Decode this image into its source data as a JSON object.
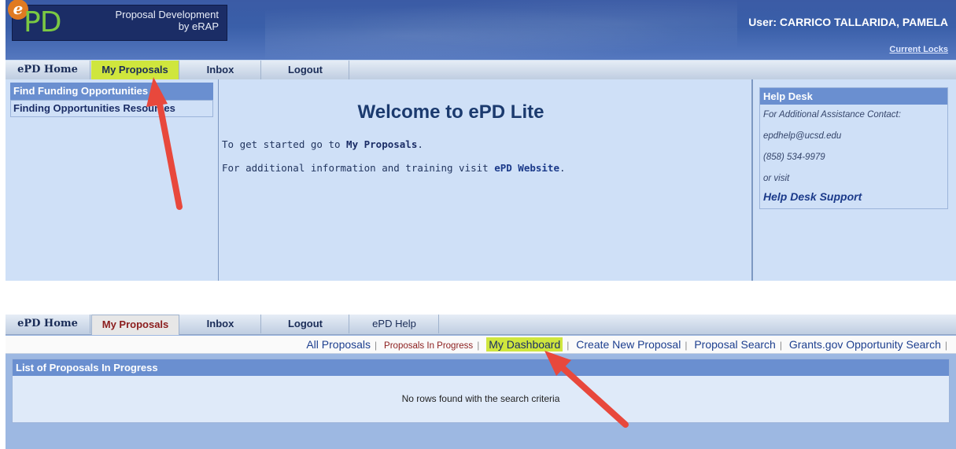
{
  "top": {
    "logo": {
      "letter": "e",
      "product": "PD",
      "title_line1": "Proposal Development",
      "title_line2": "by eRAP"
    },
    "user": "User:  CARRICO TALLARIDA, PAMELA",
    "current_locks": "Current Locks",
    "nav": [
      "ePD Home",
      "My Proposals",
      "Inbox",
      "Logout"
    ],
    "left_links": [
      "Find Funding Opportunities",
      "Finding Opportunities Resources"
    ],
    "welcome": "Welcome to ePD Lite",
    "line1_prefix": "To get started go to ",
    "line1_link": "My Proposals",
    "line1_suffix": ".",
    "line2_prefix": "For additional information and training visit ",
    "line2_link": "ePD Website",
    "line2_suffix": ".",
    "help": {
      "title": "Help Desk",
      "contact": "For Additional Assistance Contact:",
      "email": "epdhelp@ucsd.edu",
      "phone": "(858) 534-9979",
      "or_visit": "or visit",
      "support_link": "Help Desk Support"
    }
  },
  "bottom": {
    "nav": [
      "ePD Home",
      "My Proposals",
      "Inbox",
      "Logout",
      "ePD Help"
    ],
    "sub_nav": [
      "All Proposals",
      "Proposals In Progress",
      "My Dashboard",
      "Create New Proposal",
      "Proposal Search",
      "Grants.gov Opportunity Search"
    ],
    "list_title": "List of Proposals In Progress",
    "no_rows": "No rows found with the search criteria"
  },
  "colors": {
    "highlight": "#cfe63d",
    "arrow": "#e8483c",
    "panel_header": "#6a8fd0"
  }
}
